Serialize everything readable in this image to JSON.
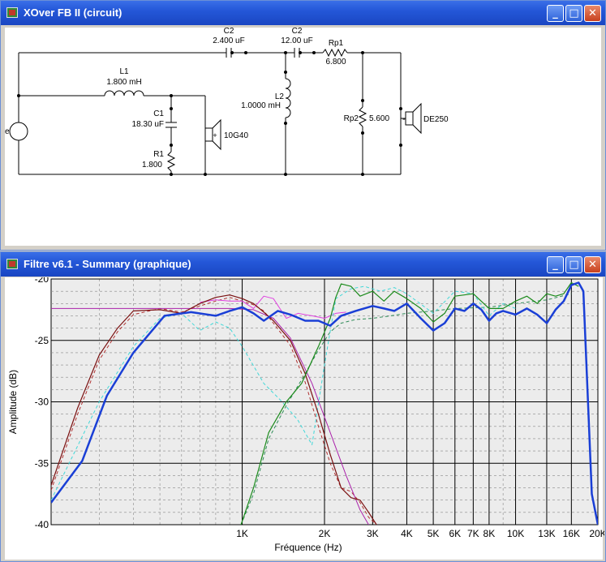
{
  "circuit_window": {
    "title": "XOver FB II (circuit)",
    "components": {
      "c2a": {
        "name": "C2",
        "value": "2.400 uF"
      },
      "c2b": {
        "name": "C2",
        "value": "12.00 uF"
      },
      "rp1": {
        "name": "Rp1",
        "value": "6.800"
      },
      "l1": {
        "name": "L1",
        "value": "1.800 mH"
      },
      "c1": {
        "name": "C1",
        "value": "18.30 uF"
      },
      "r1": {
        "name": "R1",
        "value": "1.800"
      },
      "l2": {
        "name": "L2",
        "value": "1.0000 mH"
      },
      "rp2": {
        "name": "Rp2",
        "value": "5.600"
      },
      "woofer": {
        "name": "10G40",
        "plus": "+"
      },
      "tweeter": {
        "name": "DE250",
        "minus": "-"
      },
      "source": {
        "label": "e"
      }
    }
  },
  "graph_window": {
    "title": "Filtre v6.1 - Summary (graphique)"
  },
  "window_buttons": {
    "minimize": "_",
    "maximize": "□",
    "close": "✕"
  },
  "chart_data": {
    "type": "line",
    "xlabel": "Fréquence (Hz)",
    "ylabel": "Amplitude (dB)",
    "x_scale": "log",
    "xlim": [
      200,
      20000
    ],
    "ylim": [
      -40,
      -20
    ],
    "y_ticks": [
      "-20",
      "-25",
      "-30",
      "-35",
      "-40"
    ],
    "y_tick_values": [
      -20,
      -25,
      -30,
      -35,
      -40
    ],
    "x_ticks": [
      "1K",
      "2K",
      "3K",
      "4K",
      "5K",
      "6K",
      "7K",
      "8K",
      "10K",
      "13K",
      "16K",
      "20K"
    ],
    "x_tick_values": [
      1000,
      2000,
      3000,
      4000,
      5000,
      6000,
      7000,
      8000,
      10000,
      13000,
      16000,
      20000
    ],
    "grid": true,
    "series": [
      {
        "color": "#1a3fd6",
        "style": "solid",
        "width": 2.5,
        "x": [
          200,
          260,
          320,
          400,
          520,
          650,
          800,
          900,
          1000,
          1100,
          1200,
          1350,
          1500,
          1700,
          1900,
          2100,
          2300,
          2600,
          3000,
          3300,
          3600,
          4000,
          4500,
          5000,
          5500,
          6000,
          6500,
          7000,
          7500,
          8000,
          8500,
          9000,
          10000,
          11000,
          12000,
          13000,
          14000,
          15000,
          16000,
          17000,
          17700,
          18400,
          19000,
          20000
        ],
        "y": [
          -38.2,
          -34.8,
          -29.5,
          -26.0,
          -23.0,
          -22.7,
          -23.0,
          -22.6,
          -22.3,
          -22.8,
          -23.4,
          -22.6,
          -22.9,
          -23.4,
          -23.4,
          -23.8,
          -23.0,
          -22.6,
          -22.2,
          -22.4,
          -22.6,
          -22.0,
          -23.2,
          -24.2,
          -23.6,
          -22.4,
          -22.6,
          -22.0,
          -22.5,
          -23.4,
          -22.8,
          -22.6,
          -22.9,
          -22.4,
          -22.9,
          -23.6,
          -22.5,
          -21.8,
          -20.5,
          -20.3,
          -21.0,
          -30.0,
          -37.5,
          -40.0
        ]
      },
      {
        "color": "#7a1010",
        "style": "solid",
        "width": 1.2,
        "x": [
          200,
          250,
          300,
          350,
          400,
          500,
          600,
          700,
          800,
          900,
          1000,
          1100,
          1200,
          1300,
          1500,
          1700,
          1900,
          2100,
          2300,
          2500,
          2700,
          2900,
          3100
        ],
        "y": [
          -36.8,
          -30.5,
          -26.2,
          -24.0,
          -22.6,
          -22.5,
          -22.8,
          -22.0,
          -21.5,
          -21.3,
          -21.6,
          -22.0,
          -22.7,
          -23.4,
          -25.0,
          -27.7,
          -31.0,
          -34.3,
          -37.0,
          -37.8,
          -38.0,
          -39.0,
          -40.0
        ]
      },
      {
        "color": "#b03030",
        "style": "dashed",
        "width": 1,
        "x": [
          200,
          250,
          300,
          350,
          400,
          500,
          600,
          700,
          800,
          900,
          1000,
          1100,
          1200,
          1300,
          1500,
          1700,
          1900,
          2100,
          2300,
          2500,
          2700,
          2900,
          3100
        ],
        "y": [
          -37.2,
          -31.0,
          -26.6,
          -24.3,
          -22.9,
          -22.4,
          -22.7,
          -22.2,
          -21.8,
          -21.5,
          -21.8,
          -22.1,
          -22.6,
          -23.6,
          -25.4,
          -28.4,
          -32.0,
          -35.0,
          -37.0,
          -37.3,
          -38.2,
          -39.4,
          -40.0
        ]
      },
      {
        "color": "#aa22aa",
        "style": "solid",
        "width": 1,
        "x": [
          200,
          300,
          500,
          700,
          900,
          1100,
          1300,
          1500,
          1800,
          2100,
          2400,
          2700,
          2900
        ],
        "y": [
          -22.4,
          -22.4,
          -22.4,
          -22.4,
          -22.4,
          -22.5,
          -23.2,
          -24.8,
          -28.5,
          -32.5,
          -36.0,
          -38.8,
          -40.0
        ]
      },
      {
        "color": "#e040e0",
        "style": "solid",
        "width": 1,
        "x": [
          700,
          800,
          900,
          1000,
          1100,
          1200,
          1300,
          1450,
          1600,
          1800,
          2000,
          2200,
          2400
        ],
        "y": [
          -21.9,
          -21.7,
          -21.8,
          -21.8,
          -22.4,
          -21.4,
          -21.6,
          -23.2,
          -22.8,
          -23.0,
          -23.2,
          -22.8,
          -22.7
        ]
      },
      {
        "color": "#1a8a1a",
        "style": "solid",
        "width": 1.2,
        "x": [
          990,
          1100,
          1250,
          1450,
          1650,
          1900,
          2100,
          2200,
          2300,
          2500,
          2700,
          3000,
          3300,
          3600,
          4000,
          4500,
          5000,
          5500,
          6000,
          7000,
          8000,
          9000,
          10000,
          11000,
          12000,
          13000,
          14000,
          15000,
          16000,
          17000
        ],
        "y": [
          -40.0,
          -37.0,
          -32.5,
          -30.0,
          -28.5,
          -25.5,
          -23.2,
          -21.5,
          -20.4,
          -20.6,
          -21.4,
          -21.0,
          -21.8,
          -21.0,
          -21.6,
          -22.4,
          -23.5,
          -22.8,
          -21.4,
          -21.2,
          -22.4,
          -22.4,
          -21.8,
          -21.4,
          -22.0,
          -21.2,
          -21.4,
          -21.2,
          -20.3,
          -20.6
        ]
      },
      {
        "color": "#2e8b57",
        "style": "dashed",
        "width": 1,
        "x": [
          990,
          1100,
          1250,
          1450,
          1650,
          1900,
          2100,
          2300,
          2600,
          3000,
          3500,
          4000,
          5000,
          6000,
          8000,
          10000,
          13000,
          16000
        ],
        "y": [
          -40.0,
          -37.5,
          -33.0,
          -30.3,
          -28.2,
          -25.8,
          -24.3,
          -23.6,
          -23.3,
          -23.2,
          -23.0,
          -22.8,
          -22.6,
          -22.4,
          -22.3,
          -22.0,
          -21.7,
          -21.2
        ]
      },
      {
        "color": "#40d8d8",
        "style": "dashed",
        "width": 1,
        "x": [
          200,
          300,
          400,
          500,
          600,
          700,
          800,
          900,
          1000,
          1200,
          1400,
          1600,
          1800,
          2000,
          2200,
          2500,
          2800,
          3200,
          3600,
          4000,
          5000,
          6000,
          7000,
          8000,
          9000,
          10000
        ],
        "y": [
          -38.0,
          -30.0,
          -25.5,
          -23.2,
          -22.8,
          -24.2,
          -23.5,
          -24.0,
          -25.5,
          -28.5,
          -30.0,
          -31.5,
          -33.5,
          -27.0,
          -21.6,
          -20.8,
          -20.6,
          -21.0,
          -20.7,
          -21.2,
          -22.8,
          -21.0,
          -21.2,
          -23.0,
          -22.0,
          -22.4
        ]
      }
    ]
  }
}
